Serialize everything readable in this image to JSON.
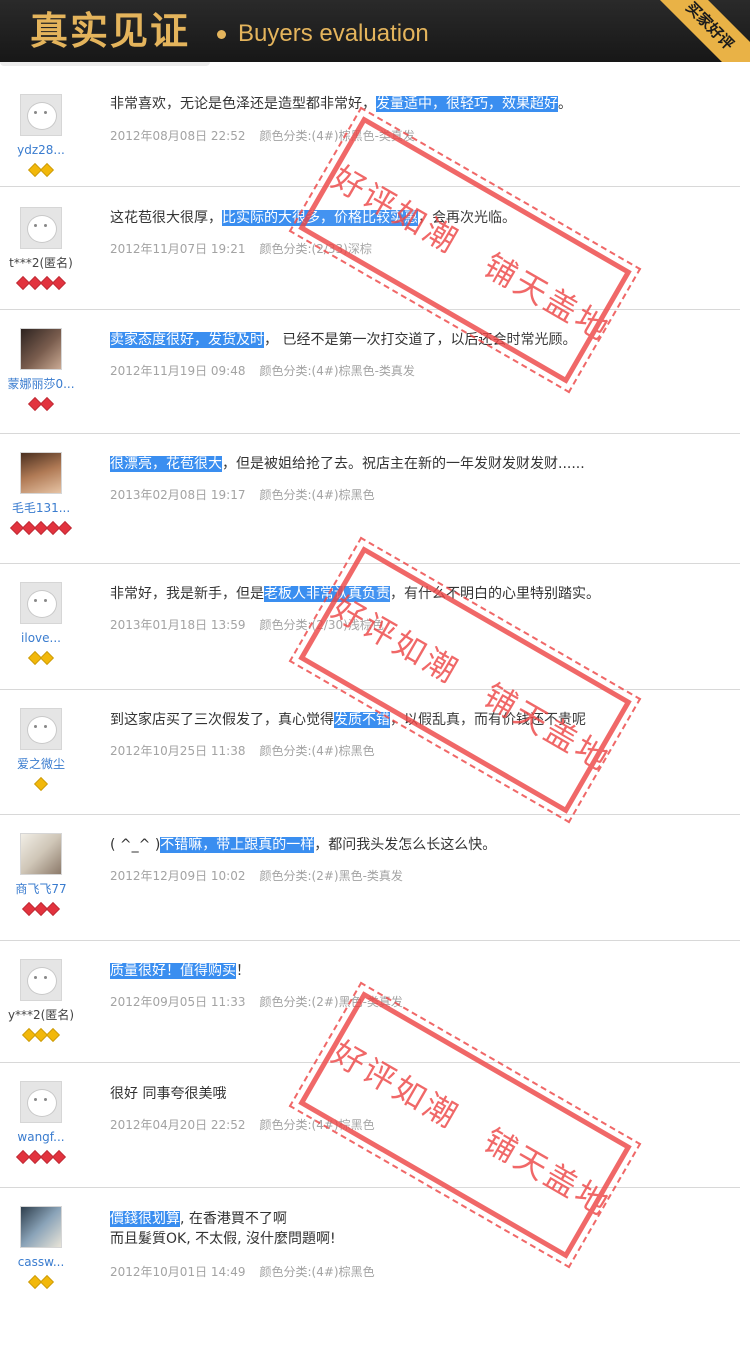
{
  "header": {
    "title_cn": "真实见证",
    "title_en": "Buyers evaluation",
    "corner": "买家好评"
  },
  "stamp_text": "好评如潮　铺天盖地",
  "colors": {
    "highlight": "#3a8ef0",
    "stamp": "#ed4848",
    "header_bg": "#1c1c1c",
    "header_text": "#e4b45c"
  },
  "reviews": [
    {
      "user": "ydz28...",
      "badges": [
        "gold",
        "gold"
      ],
      "parts": [
        "非常喜欢，无论是色泽还是造型都非常好，",
        "发量适中，很轻巧，效果超好",
        "。"
      ],
      "date": "2012年08月08日 22:52",
      "spec": "颜色分类:(4#)棕黑色-类真发"
    },
    {
      "user": "t***2(匿名)",
      "badges": [
        "red",
        "red",
        "red",
        "red"
      ],
      "parts": [
        "这花苞很大很厚，",
        "比实际的大很多，价格比较实惠",
        "，会再次光临。"
      ],
      "date": "2012年11月07日 19:21",
      "spec": "颜色分类:(2/33)深棕"
    },
    {
      "user": "蒙娜丽莎0...",
      "badges": [
        "red",
        "red"
      ],
      "parts": [
        "",
        "卖家态度很好，发货及时",
        "， 已经不是第一次打交道了，以后还会时常光顾。"
      ],
      "date": "2012年11月19日 09:48",
      "spec": "颜色分类:(4#)棕黑色-类真发"
    },
    {
      "user": "毛毛131...",
      "badges": [
        "red",
        "red",
        "red",
        "red",
        "red"
      ],
      "parts": [
        "",
        "很漂亮，花苞很大",
        "，但是被姐给抢了去。祝店主在新的一年发财发财发财......"
      ],
      "date": "2013年02月08日 19:17",
      "spec": "颜色分类:(4#)棕黑色"
    },
    {
      "user": "ilove...",
      "badges": [
        "gold",
        "gold"
      ],
      "parts": [
        "非常好，我是新手，但是",
        "老板人非常认真负责",
        "，有什么不明白的心里特别踏实。"
      ],
      "date": "2013年01月18日 13:59",
      "spec": "颜色分类:(2/30)浅棕色"
    },
    {
      "user": "爱之微尘",
      "badges": [
        "gold"
      ],
      "parts": [
        "到这家店买了三次假发了，真心觉得",
        "发质不错",
        "，以假乱真，而有价钱还不贵呢"
      ],
      "date": "2012年10月25日 11:38",
      "spec": "颜色分类:(4#)棕黑色"
    },
    {
      "user": "商飞飞77",
      "badges": [
        "red",
        "red",
        "red"
      ],
      "parts": [
        "( ^_^ )",
        "不错嘛，带上跟真的一样",
        "，都问我头发怎么长这么快。"
      ],
      "date": "2012年12月09日 10:02",
      "spec": "颜色分类:(2#)黑色-类真发"
    },
    {
      "user": "y***2(匿名)",
      "badges": [
        "gold",
        "gold",
        "gold"
      ],
      "parts": [
        "",
        "质量很好！值得购买",
        "！"
      ],
      "date": "2012年09月05日 11:33",
      "spec": "颜色分类:(2#)黑色-类真发"
    },
    {
      "user": "wangf...",
      "badges": [
        "red",
        "red",
        "red",
        "red"
      ],
      "parts": [
        "很好 同事夸很美哦",
        "",
        ""
      ],
      "date": "2012年04月20日 22:52",
      "spec": "颜色分类:(4#)棕黑色"
    },
    {
      "user": "cassw...",
      "badges": [
        "gold",
        "gold"
      ],
      "parts": [
        "",
        "價錢很划算",
        ", 在香港買不了啊"
      ],
      "line2": "而且髮質OK, 不太假, 沒什麼問題啊!",
      "date": "2012年10月01日 14:49",
      "spec": "颜色分类:(4#)棕黑色"
    }
  ]
}
